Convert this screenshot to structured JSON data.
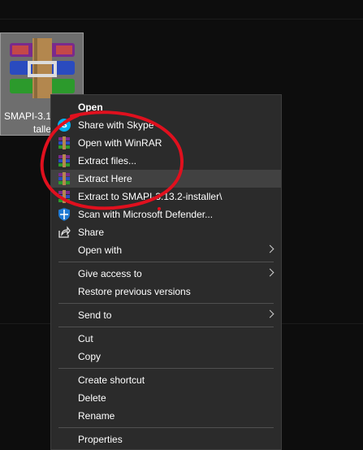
{
  "desktop": {
    "icon": {
      "name": "winrar-archive-icon",
      "label_line1": "SMAPI-3.1",
      "label_line2": "talle"
    }
  },
  "context_menu": {
    "items": [
      {
        "label": "Open",
        "icon": "none",
        "bold": true
      },
      {
        "label": "Share with Skype",
        "icon": "skype-icon"
      },
      {
        "label": "Open with WinRAR",
        "icon": "winrar-icon"
      },
      {
        "label": "Extract files...",
        "icon": "winrar-icon"
      },
      {
        "label": "Extract Here",
        "icon": "winrar-icon",
        "highlighted": true
      },
      {
        "label": "Extract to SMAPI-3.13.2-installer\\",
        "icon": "winrar-icon"
      },
      {
        "label": "Scan with Microsoft Defender...",
        "icon": "defender-shield-icon"
      },
      {
        "label": "Share",
        "icon": "share-icon"
      },
      {
        "label": "Open with",
        "icon": "none",
        "submenu": true
      },
      {
        "label": "Give access to",
        "icon": "none",
        "submenu": true
      },
      {
        "label": "Restore previous versions",
        "icon": "none"
      },
      {
        "label": "Send to",
        "icon": "none",
        "submenu": true
      },
      {
        "label": "Cut",
        "icon": "none"
      },
      {
        "label": "Copy",
        "icon": "none"
      },
      {
        "label": "Create shortcut",
        "icon": "none"
      },
      {
        "label": "Delete",
        "icon": "none"
      },
      {
        "label": "Rename",
        "icon": "none"
      },
      {
        "label": "Properties",
        "icon": "none"
      }
    ]
  },
  "colors": {
    "menu_bg": "#2b2b2b",
    "highlight_bg": "#414141",
    "annotation_red": "#e0101e",
    "skype_blue": "#00aff0",
    "defender_blue": "#1f7ad4"
  }
}
